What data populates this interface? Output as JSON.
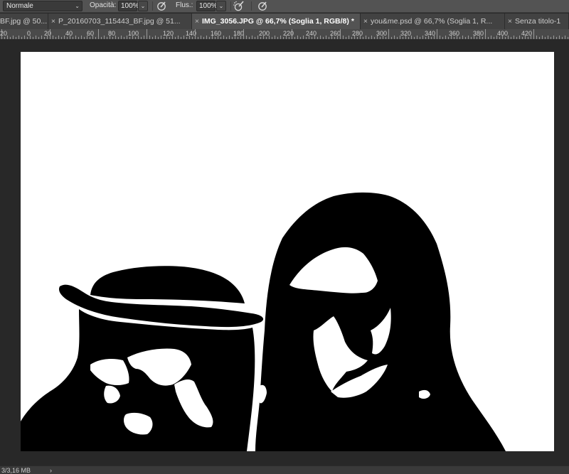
{
  "options": {
    "blend_mode": "Normale",
    "opacity_label": "Opacità:",
    "opacity_value": "100%",
    "flow_label": "Flus.:",
    "flow_value": "100%"
  },
  "tabs": [
    {
      "label": "BF.jpg @ 50..."
    },
    {
      "label": "P_20160703_115443_BF.jpg @ 51..."
    },
    {
      "label": "IMG_3056.JPG @ 66,7% (Soglia 1, RGB/8) *"
    },
    {
      "label": "you&me.psd @ 66,7% (Soglia 1, R..."
    },
    {
      "label": "Senza titolo-1"
    }
  ],
  "ruler": {
    "labels": [
      "20",
      "0",
      "20",
      "40",
      "60",
      "80",
      "100",
      "120",
      "140",
      "160",
      "180",
      "200",
      "220",
      "240",
      "260",
      "280",
      "300",
      "320",
      "340",
      "360",
      "380",
      "400",
      "420"
    ]
  },
  "status": {
    "doc_size": "3/3,16 MB",
    "arrow": "›"
  }
}
